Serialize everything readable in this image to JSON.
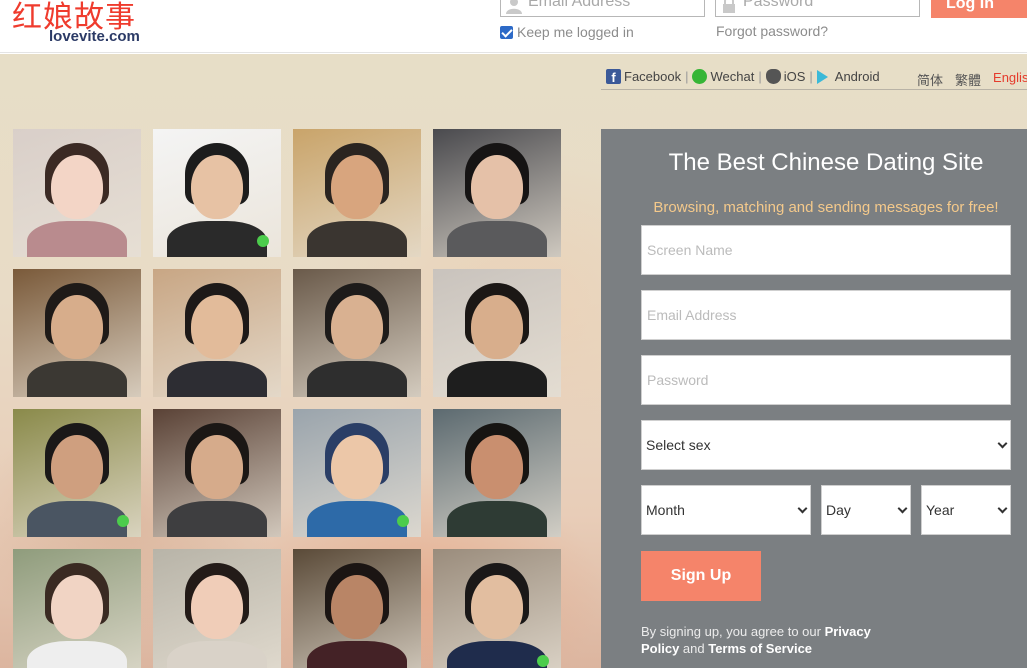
{
  "header": {
    "logo_cn": "红娘故事",
    "logo_en": "lovevite.com",
    "email_placeholder": "Email Address",
    "password_placeholder": "Password",
    "login_label": "Log In",
    "keep_logged": "Keep me logged in",
    "forgot": "Forgot password?"
  },
  "social": {
    "facebook": "Facebook",
    "wechat": "Wechat",
    "ios": "iOS",
    "android": "Android"
  },
  "languages": [
    "简体",
    "繁體",
    "English"
  ],
  "active_language": "English",
  "signup": {
    "title": "The Best Chinese Dating Site",
    "subtitle": "Browsing, matching and sending messages for free!",
    "screen_name_placeholder": "Screen Name",
    "email_placeholder": "Email Address",
    "password_placeholder": "Password",
    "sex_select": "Select sex",
    "month_select": "Month",
    "day_select": "Day",
    "year_select": "Year",
    "button": "Sign Up",
    "terms_prefix": "By signing up, you agree to our ",
    "privacy_link": "Privacy Policy",
    "terms_and": " and ",
    "terms_link": "Terms of Service"
  },
  "profiles_online": [
    false,
    true,
    false,
    false,
    false,
    false,
    false,
    false,
    true,
    false,
    true,
    false,
    false,
    false,
    false,
    true
  ],
  "colors": {
    "accent": "#f5846a",
    "panel": "#7b7f82",
    "subtitle": "#f4c98b",
    "logo_red": "#ef3b2d",
    "online": "#4ccc4c"
  }
}
